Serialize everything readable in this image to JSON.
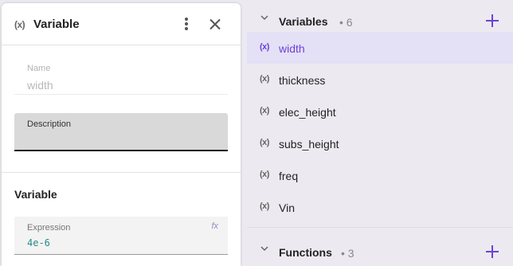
{
  "panel": {
    "icon": "variable-icon",
    "icon_glyph": "(x)",
    "title": "Variable",
    "name_field": {
      "label": "Name",
      "value": "width"
    },
    "description_field": {
      "label": "Description",
      "value": ""
    },
    "section_title": "Variable",
    "expression_field": {
      "label": "Expression",
      "value": "4e-6",
      "fx_glyph": "fx"
    }
  },
  "variables": {
    "title": "Variables",
    "count": "• 6",
    "items": [
      {
        "name": "width",
        "selected": true
      },
      {
        "name": "thickness"
      },
      {
        "name": "elec_height"
      },
      {
        "name": "subs_height"
      },
      {
        "name": "freq"
      },
      {
        "name": "Vin"
      }
    ],
    "glyph": "(x)"
  },
  "functions": {
    "title": "Functions",
    "count": "• 3"
  },
  "colors": {
    "accent": "#6b43d8",
    "selected_bg": "#e4e0f5",
    "expression_text": "#2a8a8a"
  }
}
